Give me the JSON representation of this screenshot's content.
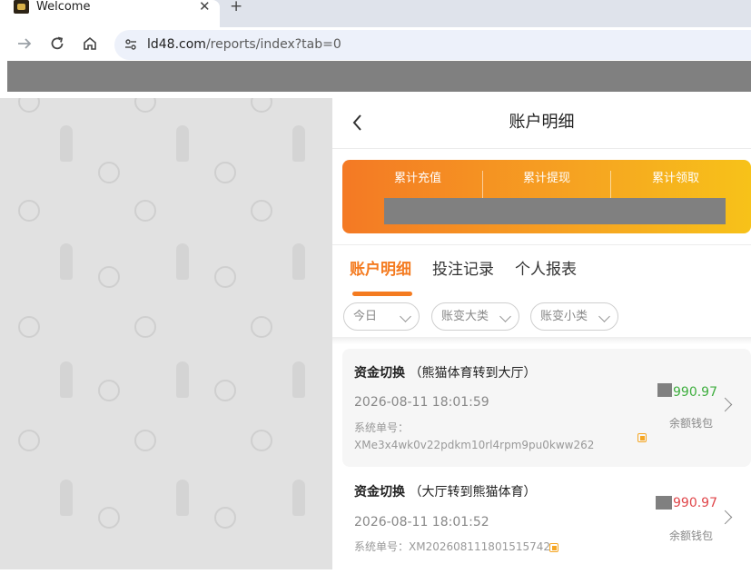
{
  "browser": {
    "tab_title": "Welcome",
    "tab_close": "✕",
    "new_tab": "+",
    "url_host": "ld48.com",
    "url_path": "/reports/index?tab=0"
  },
  "header": {
    "title": "账户明细"
  },
  "stats": {
    "labels": [
      "累计充值",
      "累计提现",
      "累计领取"
    ]
  },
  "tabs": [
    {
      "label": "账户明细",
      "active": true
    },
    {
      "label": "投注记录",
      "active": false
    },
    {
      "label": "个人报表",
      "active": false
    }
  ],
  "filters": [
    {
      "label": "今日"
    },
    {
      "label": "账变大类"
    },
    {
      "label": "账变小类"
    }
  ],
  "records": [
    {
      "type": "资金切换",
      "detail": "（熊猫体育转到大厅）",
      "time": "2026-08-11 18:01:59",
      "order_label": "系统单号：",
      "order_id": "XMe3x4wk0v22pdkm10rl4rpm9pu0kww262",
      "amount": "990.97",
      "amount_color": "#3fae3f",
      "wallet": "余额钱包"
    },
    {
      "type": "资金切换",
      "detail": "（大厅转到熊猫体育）",
      "time": "2026-08-11 18:01:52",
      "order_label": "系统单号：",
      "order_id": "XM2026081118015157​42",
      "amount": "990.97",
      "amount_color": "#e0464a",
      "wallet": "余额钱包"
    }
  ],
  "colors": {
    "accent": "#f47b20",
    "gradient_start": "#f47924",
    "gradient_end": "#f7c219"
  }
}
